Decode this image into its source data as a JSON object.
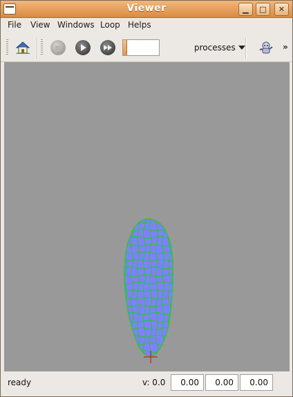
{
  "window": {
    "title": "Viewer"
  },
  "menu": {
    "items": [
      "File",
      "View",
      "Windows",
      "Loop",
      "Helps"
    ]
  },
  "toolbar": {
    "icons": [
      "home-icon",
      "stop-icon",
      "play-icon",
      "step-icon",
      "robot-icon"
    ],
    "slider_value": "",
    "processes_label": "processes",
    "overflow_label": "»"
  },
  "viewport": {
    "background": "#999999",
    "mesh_fill": "#8080ff",
    "mesh_lines": "#22cc22",
    "cursor_color": "#cc2222"
  },
  "status": {
    "text": "ready",
    "v_label": "v: 0.0",
    "fields": [
      "0.00",
      "0.00",
      "0.00"
    ]
  }
}
